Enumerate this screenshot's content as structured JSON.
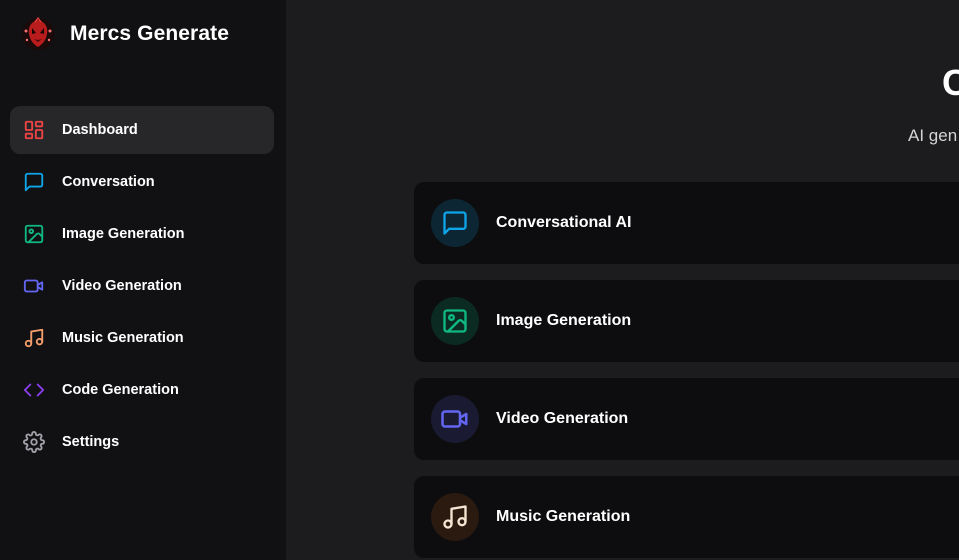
{
  "app": {
    "name": "Mercs Generate"
  },
  "sidebar": {
    "items": [
      {
        "label": "Dashboard",
        "icon": "dashboard-icon",
        "color": "#ef4444",
        "active": true
      },
      {
        "label": "Conversation",
        "icon": "chat-bubble-icon",
        "color": "#0ea5e9"
      },
      {
        "label": "Image Generation",
        "icon": "image-icon",
        "color": "#10b981"
      },
      {
        "label": "Video Generation",
        "icon": "video-camera-icon",
        "color": "#6366f1"
      },
      {
        "label": "Music Generation",
        "icon": "music-note-icon",
        "color": "#f59e6b"
      },
      {
        "label": "Code Generation",
        "icon": "code-brackets-icon",
        "color": "#8b3ff0"
      },
      {
        "label": "Settings",
        "icon": "gear-icon",
        "color": "#a1a1aa"
      }
    ]
  },
  "main": {
    "title": "C",
    "subtitle": "AI gen",
    "cards": [
      {
        "label": "Conversational AI",
        "icon": "chat-bubble-icon",
        "color": "#0ea5e9",
        "bg": "#0c2733"
      },
      {
        "label": "Image Generation",
        "icon": "image-icon",
        "color": "#10b981",
        "bg": "#0b2a22"
      },
      {
        "label": "Video Generation",
        "icon": "video-camera-icon",
        "color": "#6366f1",
        "bg": "#1a1b33"
      },
      {
        "label": "Music Generation",
        "icon": "music-note-icon",
        "color": "#f5e6d3",
        "bg": "#2a1a10"
      }
    ]
  }
}
